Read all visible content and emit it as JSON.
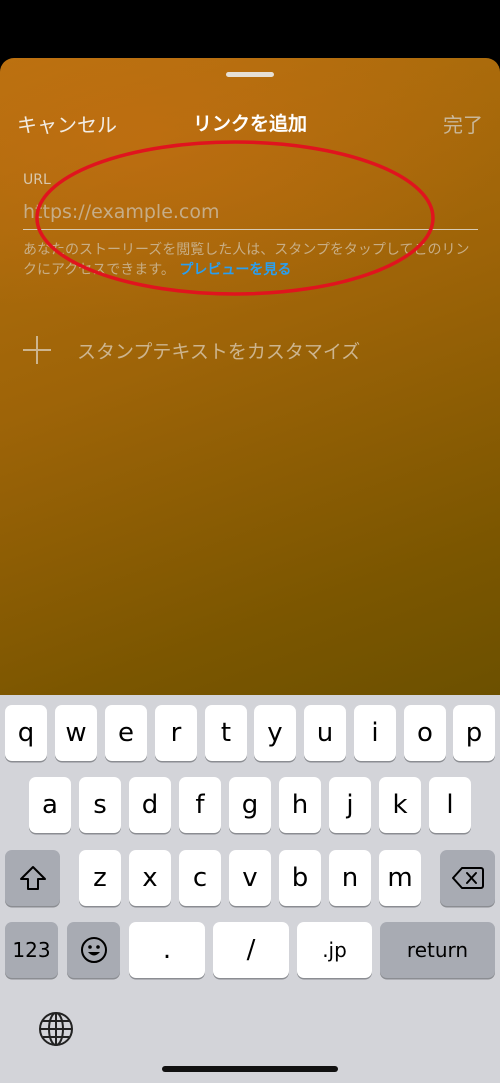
{
  "nav": {
    "cancel": "キャンセル",
    "title": "リンクを追加",
    "done": "完了"
  },
  "url": {
    "label": "URL",
    "placeholder": "https://example.com"
  },
  "help": {
    "text": "あなたのストーリーズを閲覧した人は、スタンプをタップしてこのリンクにアクセスできます。",
    "link": "プレビューを見る"
  },
  "customize": {
    "label": "スタンプテキストをカスタマイズ"
  },
  "keyboard": {
    "row1": [
      "q",
      "w",
      "e",
      "r",
      "t",
      "y",
      "u",
      "i",
      "o",
      "p"
    ],
    "row2": [
      "a",
      "s",
      "d",
      "f",
      "g",
      "h",
      "j",
      "k",
      "l"
    ],
    "row3": [
      "z",
      "x",
      "c",
      "v",
      "b",
      "n",
      "m"
    ],
    "row4": {
      "numbers": "123",
      "emoji": "☺",
      "dot": ".",
      "slash": "/",
      "domain": ".jp",
      "return": "return"
    },
    "icons": [
      "shift-icon",
      "backspace-icon",
      "emoji-icon",
      "globe-icon"
    ]
  },
  "colors": {
    "annotation": "#e0141e",
    "link": "#2a9ff0",
    "keyboard_bg": "#d3d4d9"
  }
}
